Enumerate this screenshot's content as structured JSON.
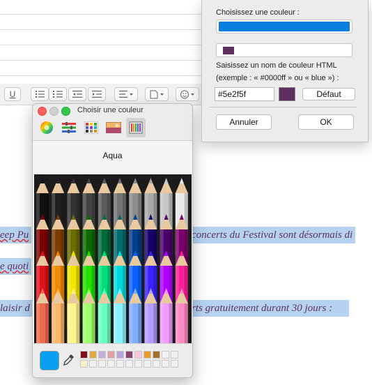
{
  "document": {
    "line1": {
      "pre": "eep Pu",
      "post": "concerts du Festival sont désormais di"
    },
    "line2": "e quoti",
    "line3": {
      "pre": "laisir d",
      "post": "rts gratuitement durant 30 jours :"
    }
  },
  "toolbar": {
    "underline_label": "U"
  },
  "color_picker": {
    "title": "Choisir une couleur",
    "selected_color_name": "Aqua",
    "current_color": "#0aa0f0",
    "favorites": [
      "#7f0e1e",
      "#e1a93e",
      "#c2b0d8",
      "#e29fa8",
      "#b7a2dd",
      "#8b4471",
      "#f9c6de",
      "#e79e2e",
      "#a1702d",
      "#f2f2f2",
      "#fbf0cc"
    ],
    "pencil_colors_row1": [
      "#111111",
      "#202020",
      "#333333",
      "#454545",
      "#5a5a5a",
      "#737373",
      "#8c8c8c",
      "#a8a8a8",
      "#c5c5c5",
      "#e8e8e8"
    ],
    "pencil_colors_row2": [
      "#7a0000",
      "#7a3f00",
      "#6b6b00",
      "#0b6b00",
      "#006b3a",
      "#006b6b",
      "#003f8c",
      "#16006b",
      "#4b006b",
      "#7a006b"
    ],
    "pencil_colors_row3": [
      "#e0101d",
      "#f08a00",
      "#f2e600",
      "#22e000",
      "#00e07a",
      "#00d9d9",
      "#0a63ff",
      "#3a22ff",
      "#b000ff",
      "#ff1e9a"
    ],
    "pencil_colors_row4": [
      "#f06a4f",
      "#ffb86a",
      "#fff58a",
      "#9dff6a",
      "#6affc2",
      "#8af0ff",
      "#7faeff",
      "#b49cff",
      "#f09cff",
      "#ff8ac5"
    ]
  },
  "html_color_dialog": {
    "choose_label": "Choisissez une couleur :",
    "blue_bar_color": "#0a7de0",
    "preview_color": "#5e2f5f",
    "html_name_label": "Saisissez un nom de couleur HTML",
    "example_label": "(exemple : « #0000ff » ou « blue ») :",
    "hex_value": "#5e2f5f",
    "default_button": "Défaut",
    "cancel_button": "Annuler",
    "ok_button": "OK"
  }
}
